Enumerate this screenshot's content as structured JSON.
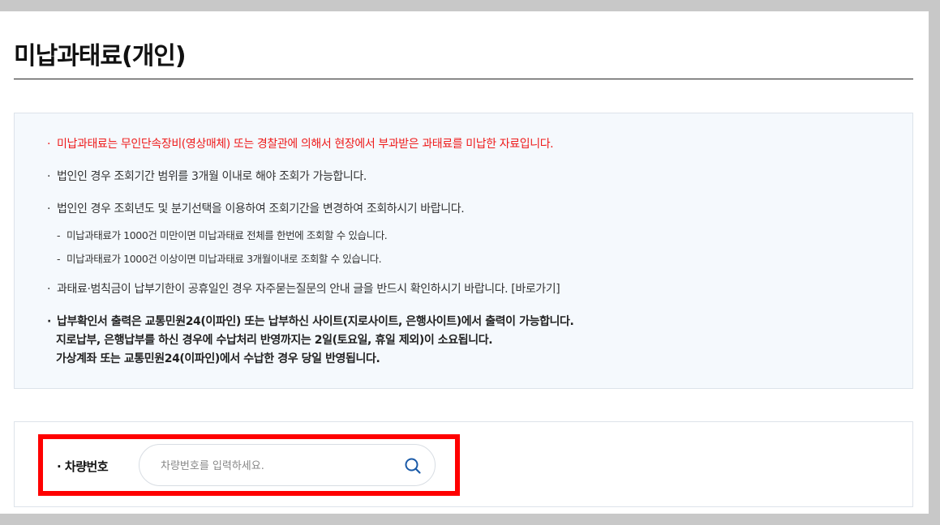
{
  "page": {
    "title": "미납과태료(개인)"
  },
  "notices": [
    {
      "bullet": "·",
      "text": "미납과태료는 무인단속장비(영상매체) 또는 경찰관에 의해서 현장에서 부과받은 과태료를 미납한 자료입니다."
    },
    {
      "bullet": "·",
      "text": "법인인 경우 조회기간 범위를 3개월 이내로 해야 조회가 가능합니다."
    },
    {
      "bullet": "·",
      "text": "법인인 경우 조회년도 및 분기선택을 이용하여 조회기간을 변경하여 조회하시기 바랍니다."
    },
    {
      "bullet": "-",
      "text": "미납과태료가 1000건 미만이면 미납과태료 전체를 한번에 조회할 수 있습니다."
    },
    {
      "bullet": "-",
      "text": "미납과태료가 1000건 이상이면 미납과태료 3개월이내로 조회할 수 있습니다."
    },
    {
      "bullet": "·",
      "text": "과태료·범칙금이 납부기한이 공휴일인 경우 자주묻는질문의 안내 글을 반드시 확인하시기 바랍니다. [바로가기]"
    },
    {
      "bullet": "·",
      "text": "납부확인서 출력은 교통민원24(이파인) 또는 납부하신 사이트(지로사이트, 은행사이트)에서 출력이 가능합니다."
    },
    {
      "text": "지로납부, 은행납부를 하신 경우에 수납처리 반영까지는 2일(토요일, 휴일 제외)이 소요됩니다."
    },
    {
      "text": "가상계좌 또는 교통민원24(이파인)에서 수납한 경우 당일 반영됩니다."
    }
  ],
  "search": {
    "label": "· 차량번호",
    "placeholder": "차량번호를 입력하세요.",
    "value": "",
    "icon": "search-icon"
  },
  "colors": {
    "notice_red": "#ee1c1c",
    "search_icon": "#1a5aa8",
    "highlight": "#ff0000",
    "info_bg": "#f5f9fd"
  }
}
